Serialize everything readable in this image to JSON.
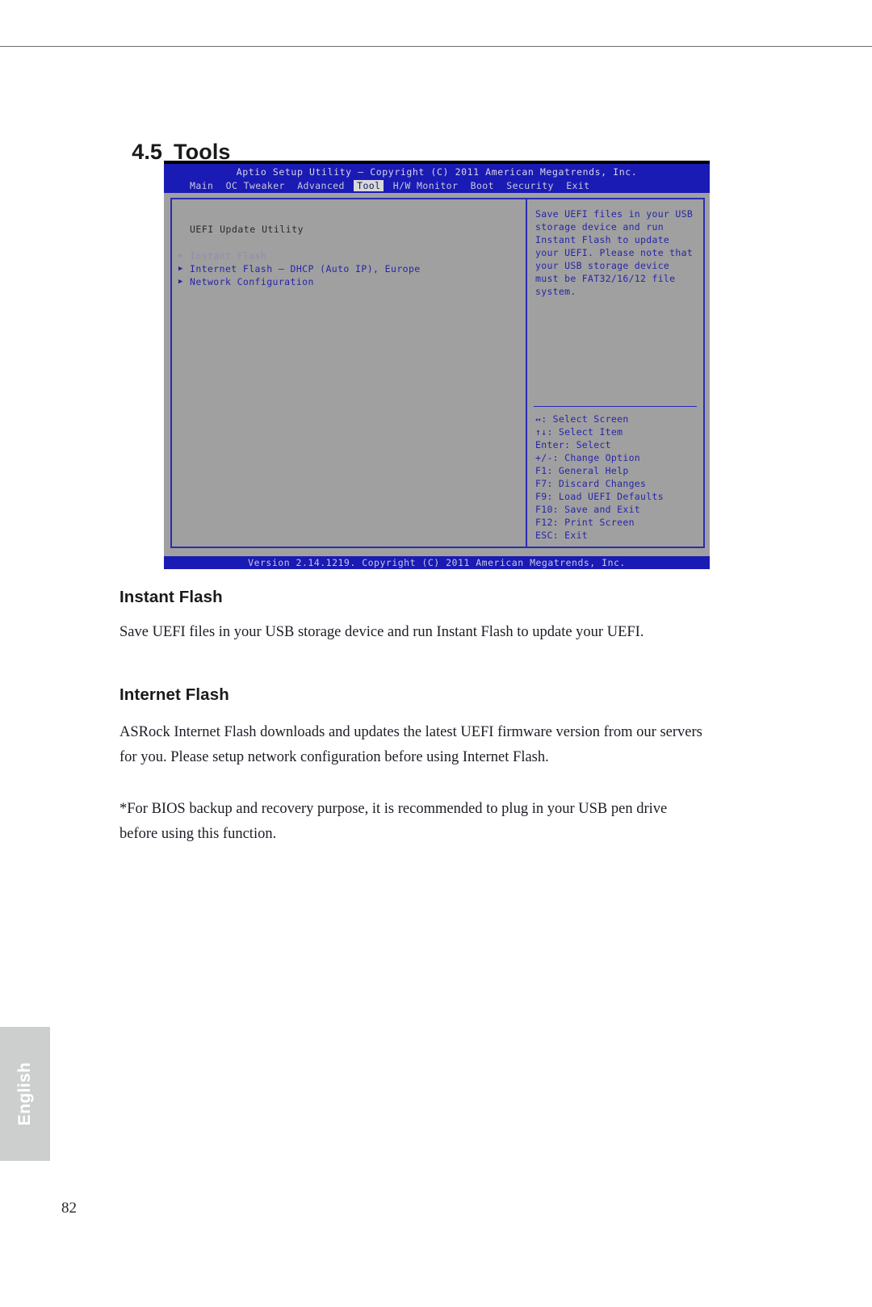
{
  "document": {
    "section_number": "4.5",
    "section_title": "Tools",
    "page_number": "82",
    "language_tab": "English"
  },
  "bios": {
    "title": "Aptio Setup Utility – Copyright (C) 2011 American Megatrends, Inc.",
    "menu": [
      {
        "label": "Main",
        "active": false
      },
      {
        "label": "OC Tweaker",
        "active": false
      },
      {
        "label": "Advanced",
        "active": false
      },
      {
        "label": "Tool",
        "active": true
      },
      {
        "label": "H/W Monitor",
        "active": false
      },
      {
        "label": "Boot",
        "active": false
      },
      {
        "label": "Security",
        "active": false
      },
      {
        "label": "Exit",
        "active": false
      }
    ],
    "utility_label": "UEFI Update Utility",
    "items": [
      {
        "label": "Instant Flash",
        "dim": true
      },
      {
        "label": "Internet Flash – DHCP (Auto IP), Europe",
        "dim": false
      },
      {
        "label": "Network Configuration",
        "dim": false
      }
    ],
    "help_text": "Save UEFI files in your USB storage device and run Instant Flash to update your UEFI. Please note that your USB storage device must be FAT32/16/12 file system.",
    "legend": [
      "↔: Select Screen",
      "↑↓: Select Item",
      "Enter: Select",
      "+/-: Change Option",
      "F1: General Help",
      "F7: Discard Changes",
      "F9: Load UEFI Defaults",
      "F10: Save and Exit",
      "F12: Print Screen",
      "ESC: Exit"
    ],
    "footer": "Version 2.14.1219. Copyright (C) 2011 American Megatrends, Inc.",
    "colors": {
      "chrome_blue": "#1a1ab4",
      "panel_gray": "#a0a0a0",
      "text_blue": "#2626a8",
      "active_tab_bg": "#d9d9d9"
    }
  },
  "sections": [
    {
      "heading": "Instant Flash",
      "body": "Save UEFI files in your USB storage device and run Instant Flash to update your UEFI."
    },
    {
      "heading": "Internet Flash",
      "body": "ASRock Internet Flash downloads and updates the latest UEFI firmware version from our servers for you. Please setup network configuration before using Internet Flash.",
      "note": "*For BIOS backup and recovery purpose, it is recommended to plug in your USB pen drive before using this function."
    }
  ]
}
